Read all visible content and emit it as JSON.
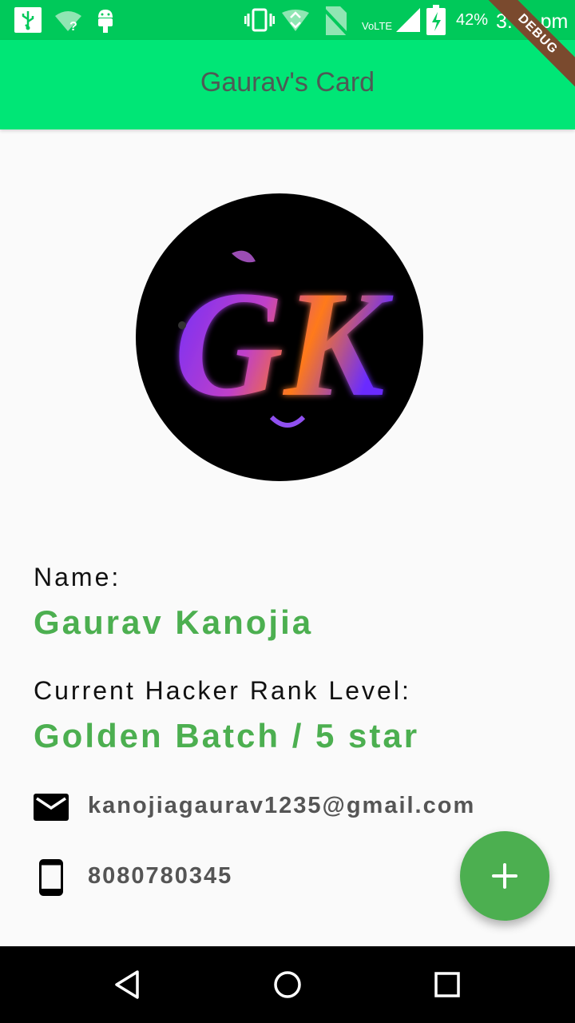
{
  "status_bar": {
    "network_type": "VoLTE",
    "battery": "42%",
    "time": "3:46 pm",
    "icons": [
      "usb-icon",
      "wifi-question-icon",
      "android-icon",
      "vibrate-icon",
      "data-icon",
      "no-sim-icon",
      "signal-icon",
      "battery-charging-icon"
    ]
  },
  "debug_banner": "DEBUG",
  "app_bar": {
    "title": "Gaurav's Card"
  },
  "profile": {
    "avatar_monogram": "GK",
    "name_label": "Name:",
    "name": "Gaurav Kanojia",
    "rank_label": "Current Hacker Rank Level:",
    "rank": "Golden Batch / 5 star",
    "email": "kanojiagaurav1235@gmail.com",
    "phone": "8080780345",
    "email_icon": "mail-icon",
    "phone_icon": "phone-icon"
  },
  "fab": {
    "icon": "add-icon",
    "symbol": "+"
  },
  "nav": {
    "icons": [
      "back-icon",
      "home-icon",
      "recents-icon"
    ]
  },
  "colors": {
    "status_bar": "#00c95a",
    "app_bar": "#00e676",
    "accent_green": "#4caf50",
    "title_text": "#4e5a55",
    "background": "#fafafa"
  }
}
